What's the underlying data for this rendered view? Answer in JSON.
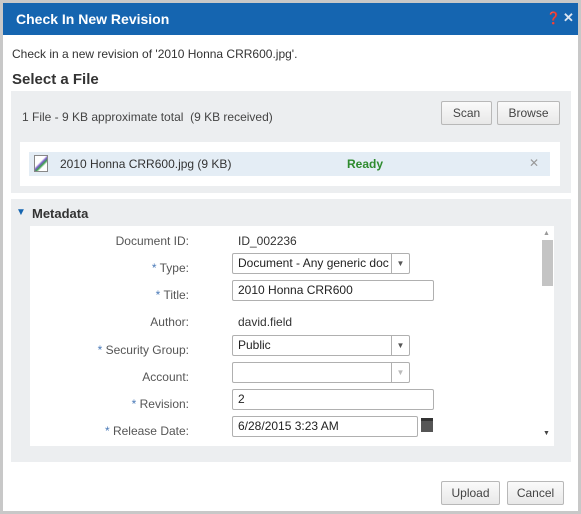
{
  "dialog": {
    "title": "Check In New Revision",
    "help_icon": "help-icon",
    "close_icon": "close-icon"
  },
  "intro": "Check in a new revision of '2010 Honna CRR600.jpg'.",
  "select_file": {
    "heading": "Select a File",
    "summary": "1 File - 9 KB approximate total  (9 KB received)",
    "scan_label": "Scan",
    "browse_label": "Browse",
    "file": {
      "name": "2010 Honna CRR600.jpg (9 KB)",
      "status": "Ready",
      "status_color": "#2e8b2e"
    }
  },
  "metadata": {
    "heading": "Metadata",
    "fields": {
      "doc_id": {
        "label": "Document ID:",
        "value": "ID_002236"
      },
      "type": {
        "label": "Type:",
        "value": "Document - Any generic doc"
      },
      "title": {
        "label": "Title:",
        "value": "2010 Honna CRR600"
      },
      "author": {
        "label": "Author:",
        "value": "david.field"
      },
      "security_group": {
        "label": "Security Group:",
        "value": "Public"
      },
      "account": {
        "label": "Account:",
        "value": ""
      },
      "revision": {
        "label": "Revision:",
        "value": "2"
      },
      "release_date": {
        "label": "Release Date:",
        "value": "6/28/2015 3:23 AM"
      }
    },
    "required_mark": "*"
  },
  "footer": {
    "upload_label": "Upload",
    "cancel_label": "Cancel"
  },
  "colors": {
    "header": "#1565b0",
    "panel": "#eceef0"
  }
}
